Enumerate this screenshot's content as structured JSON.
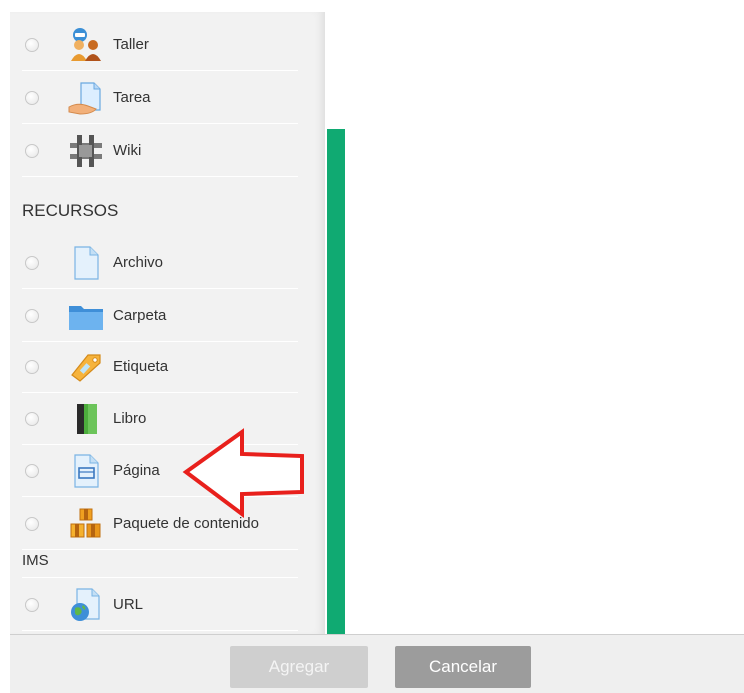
{
  "activities": [
    {
      "label": "Taller",
      "icon": "workshop-icon"
    },
    {
      "label": "Tarea",
      "icon": "assignment-icon"
    },
    {
      "label": "Wiki",
      "icon": "wiki-icon"
    }
  ],
  "resources_heading": "RECURSOS",
  "resources": [
    {
      "label": "Archivo",
      "icon": "file-icon"
    },
    {
      "label": "Carpeta",
      "icon": "folder-icon"
    },
    {
      "label": "Etiqueta",
      "icon": "label-tag-icon"
    },
    {
      "label": "Libro",
      "icon": "book-icon"
    },
    {
      "label": "Página",
      "icon": "page-icon"
    },
    {
      "label": "Paquete de contenido",
      "icon": "ims-package-icon"
    },
    {
      "label": "URL",
      "icon": "url-icon"
    }
  ],
  "ims_continuation": "IMS",
  "buttons": {
    "add": "Agregar",
    "cancel": "Cancelar"
  },
  "colors": {
    "accent_bar": "#10aa72",
    "arrow": "#e8201c"
  }
}
